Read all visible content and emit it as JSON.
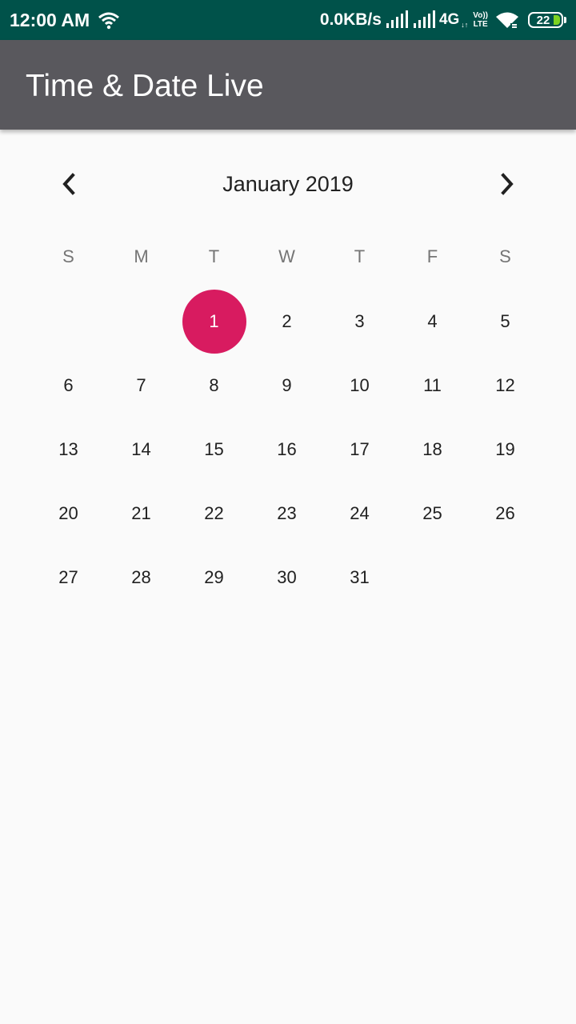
{
  "status_bar": {
    "time": "12:00 AM",
    "net_speed": "0.0KB/s",
    "network_type": "4G",
    "network_sub": "↓↑",
    "volte_top": "Vo))",
    "volte_bottom": "LTE",
    "battery": "22",
    "battery_color": "#7ed321"
  },
  "app_bar": {
    "title": "Time & Date Live",
    "color": "#59585d"
  },
  "calendar": {
    "month_label": "January 2019",
    "prev_icon": "chevron-left-icon",
    "next_icon": "chevron-right-icon",
    "weekdays": [
      "S",
      "M",
      "T",
      "W",
      "T",
      "F",
      "S"
    ],
    "selected_day": "1",
    "selected_color": "#d81b60",
    "weeks": [
      [
        "",
        "",
        "1",
        "2",
        "3",
        "4",
        "5"
      ],
      [
        "6",
        "7",
        "8",
        "9",
        "10",
        "11",
        "12"
      ],
      [
        "13",
        "14",
        "15",
        "16",
        "17",
        "18",
        "19"
      ],
      [
        "20",
        "21",
        "22",
        "23",
        "24",
        "25",
        "26"
      ],
      [
        "27",
        "28",
        "29",
        "30",
        "31",
        "",
        ""
      ]
    ]
  }
}
